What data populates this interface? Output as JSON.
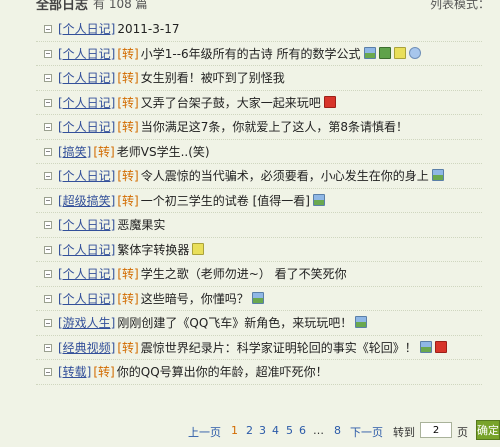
{
  "header": {
    "title": "全部日志",
    "count_text": "有 108 篇",
    "list_mode": "列表模式："
  },
  "entries": [
    {
      "category": "[个人日记]",
      "tag": "",
      "title": "2011-3-17",
      "icons": []
    },
    {
      "category": "[个人日记]",
      "tag": "[转]",
      "title": "小学1--6年级所有的古诗  所有的数学公式",
      "icons": [
        "picture-icon",
        "dollar-icon",
        "note-icon",
        "sound-icon"
      ]
    },
    {
      "category": "[个人日记]",
      "tag": "[转]",
      "title": "女生别看！被吓到了别怪我",
      "icons": []
    },
    {
      "category": "[个人日记]",
      "tag": "[转]",
      "title": "又弄了台架子鼓，大家一起来玩吧",
      "icons": [
        "flash-icon"
      ]
    },
    {
      "category": "[个人日记]",
      "tag": "[转]",
      "title": "当你满足这7条，你就爱上了这人，第8条请慎看！",
      "icons": []
    },
    {
      "category": "[搞笑]",
      "tag": "[转]",
      "title": "老师VS学生..(笑)",
      "icons": []
    },
    {
      "category": "[个人日记]",
      "tag": "[转]",
      "title": "令人震惊的当代骗术，必须要看，小心发生在你的身上",
      "icons": [
        "picture-icon"
      ]
    },
    {
      "category": "[超级搞笑]",
      "tag": "[转]",
      "title": "一个初三学生的试卷 [值得一看]",
      "icons": [
        "picture-icon"
      ]
    },
    {
      "category": "[个人日记]",
      "tag": "",
      "title": "恶魔果实",
      "icons": []
    },
    {
      "category": "[个人日记]",
      "tag": "",
      "title": "繁体字转换器",
      "icons": [
        "note-icon"
      ]
    },
    {
      "category": "[个人日记]",
      "tag": "[转]",
      "title": "学生之歌（老师勿进~） 看了不笑死你",
      "icons": []
    },
    {
      "category": "[个人日记]",
      "tag": "[转]",
      "title": "这些暗号，你懂吗？",
      "icons": [
        "picture-icon"
      ]
    },
    {
      "category": "[游戏人生]",
      "tag": "",
      "title": "刚刚创建了《QQ飞车》新角色，来玩玩吧！",
      "icons": [
        "picture-icon"
      ]
    },
    {
      "category": "[经典视频]",
      "tag": "[转]",
      "title": "震惊世界纪录片：科学家证明轮回的事实《轮回》！",
      "icons": [
        "picture-icon",
        "flash-icon"
      ]
    },
    {
      "category": "[转载]",
      "tag": "[转]",
      "title": "你的QQ号算出你的年龄，超准吓死你！",
      "icons": []
    }
  ],
  "pager": {
    "prev": "上一页",
    "pages": [
      "1",
      "2",
      "3",
      "4",
      "5",
      "6"
    ],
    "current": "1",
    "ellipsis": "…",
    "last": "8",
    "next": "下一页",
    "goto_label": "转到",
    "goto_value": "2",
    "page_suffix": "页",
    "confirm": "确定"
  }
}
